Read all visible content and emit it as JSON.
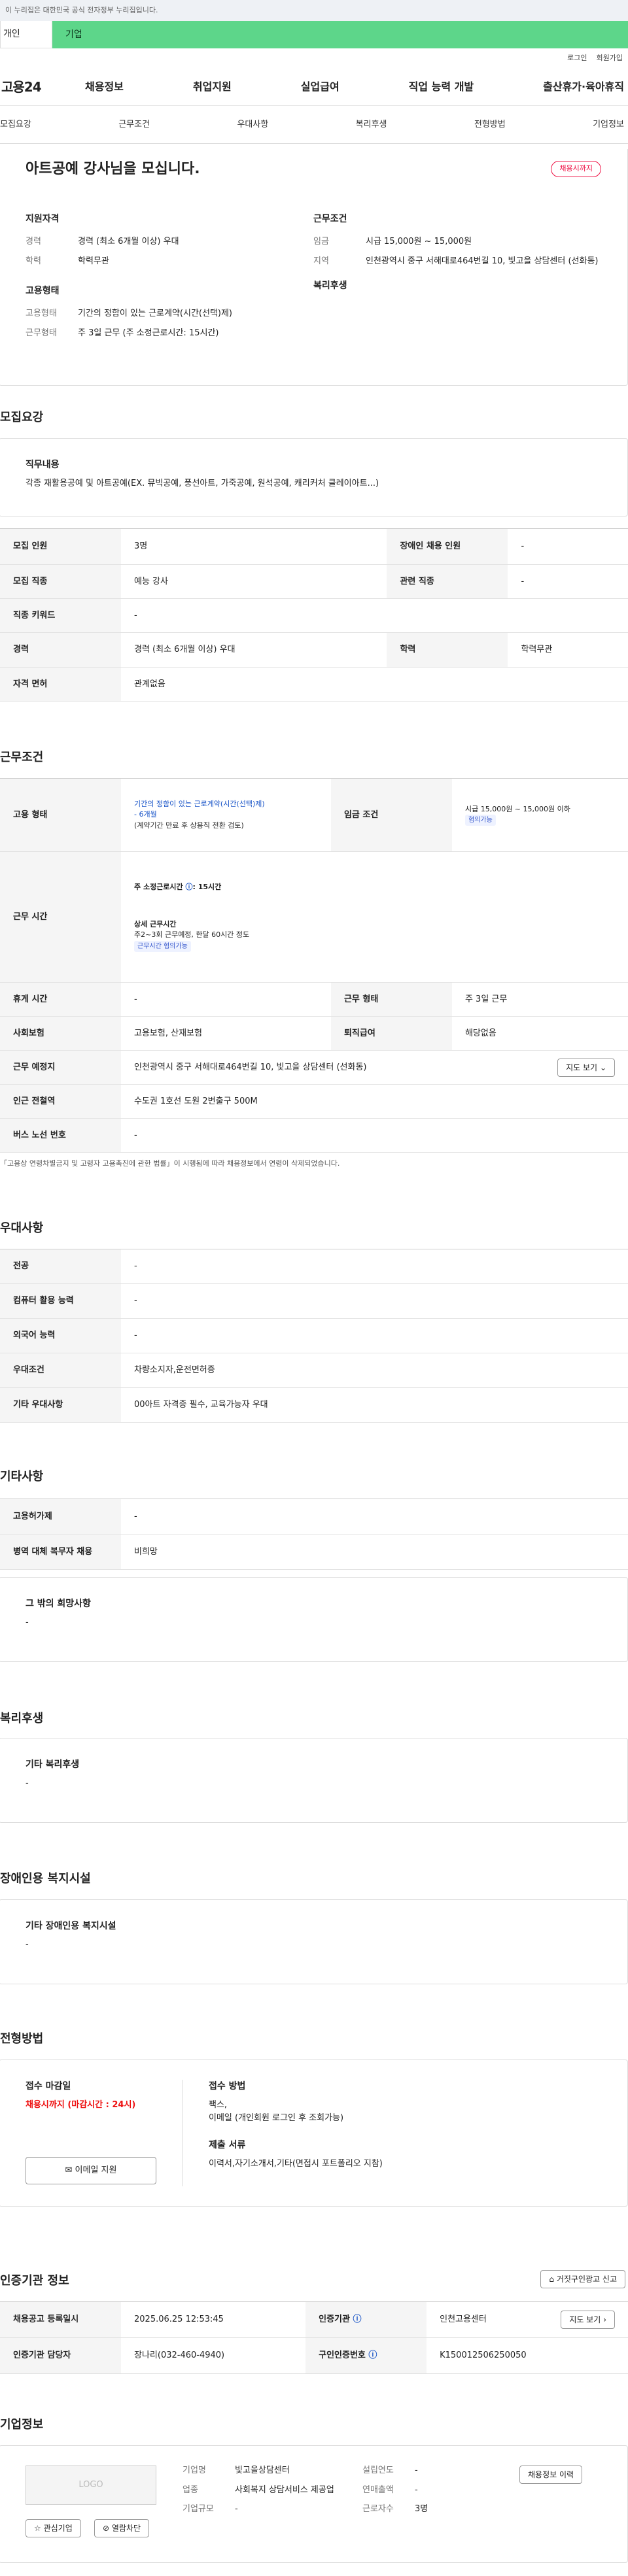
{
  "gov_notice": "이 누리집은 대한민국 공식 전자정부 누리집입니다.",
  "tabs": {
    "personal": "개인",
    "company": "기업"
  },
  "util": {
    "login": "로그인",
    "join": "회원가입"
  },
  "logo": "고용24",
  "gnb": [
    "채용정보",
    "취업지원",
    "실업급여",
    "직업 능력 개발",
    "출산휴가·육아휴직"
  ],
  "subtabs": [
    "모집요강",
    "근무조건",
    "우대사항",
    "복리후생",
    "전형방법",
    "기업정보"
  ],
  "header": {
    "title": "아트공예 강사님을 모십니다.",
    "status": "채용시까지"
  },
  "summary": {
    "qual_title": "지원자격",
    "cond_title": "근무조건",
    "type_title": "고용형태",
    "welfare_title": "복리후생",
    "career_k": "경력",
    "career_v": "경력 (최소 6개월 이상) 우대",
    "edu_k": "학력",
    "edu_v": "학력무관",
    "wage_k": "임금",
    "wage_v": "시급 15,000원 ~ 15,000원",
    "area_k": "지역",
    "area_v": "인천광역시 중구 서해대로464번길 10, 빛고을 상담센터 (선화동)",
    "emp_k": "고용형태",
    "emp_v": "기간의 정함이 있는 근로계약(시간(선택)제)",
    "work_k": "근무형태",
    "work_v": "주 3일 근무 (주 소정근로시간: 15시간)"
  },
  "recruit": {
    "section": "모집요강",
    "duty_title": "직무내용",
    "duty_v": "각종 재활용공예 및 아트공예(EX. 뮤빅공예, 풍선아트, 가죽공예, 원석공예, 캐리커처 클레이아트...)",
    "rows": [
      {
        "k1": "모집 인원",
        "v1": "3명",
        "k2": "장애인 채용 인원",
        "v2": "-"
      },
      {
        "k1": "모집 직종",
        "v1": "예능 강사",
        "k2": "관련 직종",
        "v2": "-"
      },
      {
        "k1": "직종 키워드",
        "v1": "-"
      },
      {
        "k1": "경력",
        "v1": "경력 (최소 6개월 이상) 우대",
        "k2": "학력",
        "v2": "학력무관"
      },
      {
        "k1": "자격 면허",
        "v1": "관계없음"
      }
    ]
  },
  "condition": {
    "section": "근무조건",
    "emp_k": "고용 형태",
    "emp_v1": "기간의 정함이 있는 근로계약(시간(선택)제)",
    "emp_v2": "- 6개월",
    "emp_v3": "(계약기간 만료 후 상용직 전환 검토)",
    "wage_k": "임금 조건",
    "wage_v": "시급 15,000원 ~ 15,000원 이하",
    "wage_badge": "협의가능",
    "time_k": "근무 시간",
    "time_v1": "주 소정근로시간",
    "time_v1b": ": 15시간",
    "time_v2": "상세 근무시간",
    "time_v3": "주2~3회 근무예정, 한달 60시간 정도",
    "time_badge": "근무시간 협의가능",
    "rest_k": "휴게 시간",
    "rest_v": "-",
    "form_k": "근무 형태",
    "form_v": "주 3일 근무",
    "ins_k": "사회보험",
    "ins_v": "고용보험, 산재보험",
    "ret_k": "퇴직급여",
    "ret_v": "해당없음",
    "loc_k": "근무 예정지",
    "loc_v": "인천광역시 중구 서해대로464번길 10, 빛고을 상담센터 (선화동)",
    "map_btn": "지도 보기",
    "sub_k": "인근 전철역",
    "sub_v": "수도권 1호선 도원 2번출구 500M",
    "bus_k": "버스 노선 번호",
    "bus_v": "-",
    "note": "「고용상 연령차별금지 및 고령자 고용촉진에 관한 법률」이 시행됨에 따라 채용정보에서 연령이 삭제되었습니다."
  },
  "pref": {
    "section": "우대사항",
    "rows": [
      {
        "k": "전공",
        "v": "-"
      },
      {
        "k": "컴퓨터 활용 능력",
        "v": "-"
      },
      {
        "k": "외국어 능력",
        "v": "-"
      },
      {
        "k": "우대조건",
        "v": "차량소지자,운전면허증"
      },
      {
        "k": "기타 우대사항",
        "v": "00아트 자격증 필수, 교육가능자 우대"
      }
    ]
  },
  "etc": {
    "section": "기타사항",
    "rows": [
      {
        "k": "고용허가제",
        "v": "-"
      },
      {
        "k": "병역 대체 복무자 채용",
        "v": "비희망"
      }
    ],
    "other_title": "그 밖의 희망사항",
    "other_v": "-"
  },
  "welfare": {
    "section": "복리후생",
    "title": "기타 복리후생",
    "v": "-"
  },
  "disabled": {
    "section": "장애인용 복지시설",
    "title": "기타 장애인용 복지시설",
    "v": "-"
  },
  "process": {
    "section": "전형방법",
    "deadline_title": "접수 마감일",
    "deadline_v": "채용시까지 (마감시간 : 24시)",
    "email_btn": "이메일 지원",
    "method_title": "접수 방법",
    "method_v1": "팩스,",
    "method_v2": "이메일 (개인회원 로그인 후 조회가능)",
    "docs_title": "제출 서류",
    "docs_v": "이력서,자기소개서,기타(면접시 포트폴리오 지참)"
  },
  "agency": {
    "section": "인증기관 정보",
    "report_btn": "거짓구인광고 신고",
    "reg_k": "채용공고 등록일시",
    "reg_v": "2025.06.25 12:53:45",
    "org_k": "인증기관",
    "org_v": "인천고용센터",
    "map_btn": "지도 보기",
    "mgr_k": "인증기관 담당자",
    "mgr_v": "장나리(032-460-4940)",
    "no_k": "구인인증번호",
    "no_v": "K150012506250050"
  },
  "company": {
    "section": "기업정보",
    "logo": "LOGO",
    "fav_btn": "관심기업",
    "block_btn": "열람차단",
    "name_k": "기업명",
    "name_v": "빛고을상담센터",
    "ind_k": "업종",
    "ind_v": "사회복지 상담서비스 제공업",
    "size_k": "기업규모",
    "size_v": "-",
    "year_k": "설립연도",
    "year_v": "-",
    "sales_k": "연매출액",
    "sales_v": "-",
    "emp_k": "근로자수",
    "emp_v": "3명",
    "history_btn": "채용정보 이력"
  }
}
